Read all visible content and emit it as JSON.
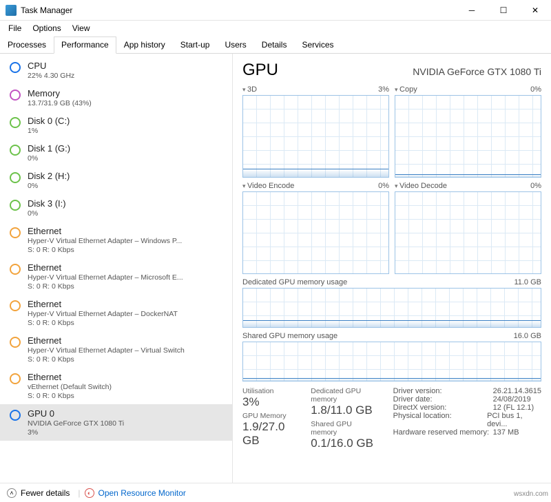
{
  "window": {
    "title": "Task Manager"
  },
  "menu": [
    "File",
    "Options",
    "View"
  ],
  "tabs": [
    "Processes",
    "Performance",
    "App history",
    "Start-up",
    "Users",
    "Details",
    "Services"
  ],
  "activeTab": 1,
  "sidebar": [
    {
      "name": "CPU",
      "sub": "22% 4.30 GHz",
      "color": "blue"
    },
    {
      "name": "Memory",
      "sub": "13.7/31.9 GB (43%)",
      "color": "purple"
    },
    {
      "name": "Disk 0 (C:)",
      "sub": "1%",
      "color": "green"
    },
    {
      "name": "Disk 1 (G:)",
      "sub": "0%",
      "color": "green"
    },
    {
      "name": "Disk 2 (H:)",
      "sub": "0%",
      "color": "green"
    },
    {
      "name": "Disk 3 (I:)",
      "sub": "0%",
      "color": "green"
    },
    {
      "name": "Ethernet",
      "sub": "Hyper-V Virtual Ethernet Adapter – Windows P...",
      "sub2": "S: 0 R: 0 Kbps",
      "color": "orange"
    },
    {
      "name": "Ethernet",
      "sub": "Hyper-V Virtual Ethernet Adapter – Microsoft E...",
      "sub2": "S: 0 R: 0 Kbps",
      "color": "orange"
    },
    {
      "name": "Ethernet",
      "sub": "Hyper-V Virtual Ethernet Adapter – DockerNAT",
      "sub2": "S: 0 R: 0 Kbps",
      "color": "orange"
    },
    {
      "name": "Ethernet",
      "sub": "Hyper-V Virtual Ethernet Adapter – Virtual Switch",
      "sub2": "S: 0 R: 0 Kbps",
      "color": "orange"
    },
    {
      "name": "Ethernet",
      "sub": "vEthernet (Default Switch)",
      "sub2": "S: 0 R: 0 Kbps",
      "color": "orange"
    },
    {
      "name": "GPU 0",
      "sub": "NVIDIA GeForce GTX 1080 Ti",
      "sub2": "3%",
      "color": "blue",
      "selected": true
    }
  ],
  "main": {
    "title": "GPU",
    "device": "NVIDIA GeForce GTX 1080 Ti",
    "graphs": [
      {
        "label": "3D",
        "pct": "3%"
      },
      {
        "label": "Copy",
        "pct": "0%"
      },
      {
        "label": "Video Encode",
        "pct": "0%"
      },
      {
        "label": "Video Decode",
        "pct": "0%"
      }
    ],
    "mem1": {
      "label": "Dedicated GPU memory usage",
      "max": "11.0 GB"
    },
    "mem2": {
      "label": "Shared GPU memory usage",
      "max": "16.0 GB"
    },
    "stats": {
      "util_l": "Utilisation",
      "util": "3%",
      "gmem_l": "GPU Memory",
      "gmem": "1.9/27.0 GB",
      "ded_l": "Dedicated GPU memory",
      "ded": "1.8/11.0 GB",
      "shr_l": "Shared GPU memory",
      "shr": "0.1/16.0 GB"
    },
    "info": [
      [
        "Driver version:",
        "26.21.14.3615"
      ],
      [
        "Driver date:",
        "24/08/2019"
      ],
      [
        "DirectX version:",
        "12 (FL 12.1)"
      ],
      [
        "Physical location:",
        "PCI bus 1, devi..."
      ],
      [
        "Hardware reserved memory:",
        "137 MB"
      ]
    ]
  },
  "footer": {
    "fewer": "Fewer details",
    "monitor": "Open Resource Monitor"
  },
  "watermark": "wsxdn.com",
  "chart_data": {
    "type": "line",
    "title": "GPU engine utilisation (%)",
    "ylim": [
      0,
      100
    ],
    "series": [
      {
        "name": "3D",
        "values": [
          1,
          1,
          1,
          1,
          2,
          2,
          1,
          1,
          1,
          1,
          2,
          2,
          1,
          3,
          6,
          4,
          2,
          2,
          1,
          2,
          3
        ]
      },
      {
        "name": "Copy",
        "values": [
          0,
          0,
          0,
          0,
          0,
          0,
          0,
          0,
          0,
          0,
          0,
          0,
          0,
          0,
          0,
          0,
          0,
          0,
          0,
          1,
          0
        ]
      },
      {
        "name": "Video Encode",
        "values": [
          0,
          0,
          0,
          0,
          0,
          0,
          0,
          0,
          0,
          0,
          0,
          0,
          0,
          0,
          0,
          0,
          0,
          0,
          0,
          0,
          0
        ]
      },
      {
        "name": "Video Decode",
        "values": [
          0,
          0,
          0,
          0,
          0,
          0,
          0,
          0,
          0,
          0,
          0,
          0,
          0,
          0,
          0,
          0,
          0,
          0,
          0,
          0,
          0
        ]
      },
      {
        "name": "Dedicated GPU memory (GB)",
        "values": [
          1.8,
          1.8,
          1.8,
          1.8,
          1.8,
          1.8,
          1.8,
          1.8,
          1.8,
          1.8,
          1.8,
          1.8,
          1.8,
          1.8,
          1.8,
          1.8,
          1.8,
          1.8,
          1.8,
          1.8,
          1.8
        ],
        "ylim": [
          0,
          11
        ]
      },
      {
        "name": "Shared GPU memory (GB)",
        "values": [
          0.1,
          0.1,
          0.1,
          0.1,
          0.1,
          0.1,
          0.1,
          0.1,
          0.1,
          0.1,
          0.1,
          0.1,
          0.1,
          0.1,
          0.1,
          0.1,
          0.1,
          0.1,
          0.1,
          0.1,
          0.1
        ],
        "ylim": [
          0,
          16
        ]
      }
    ]
  }
}
